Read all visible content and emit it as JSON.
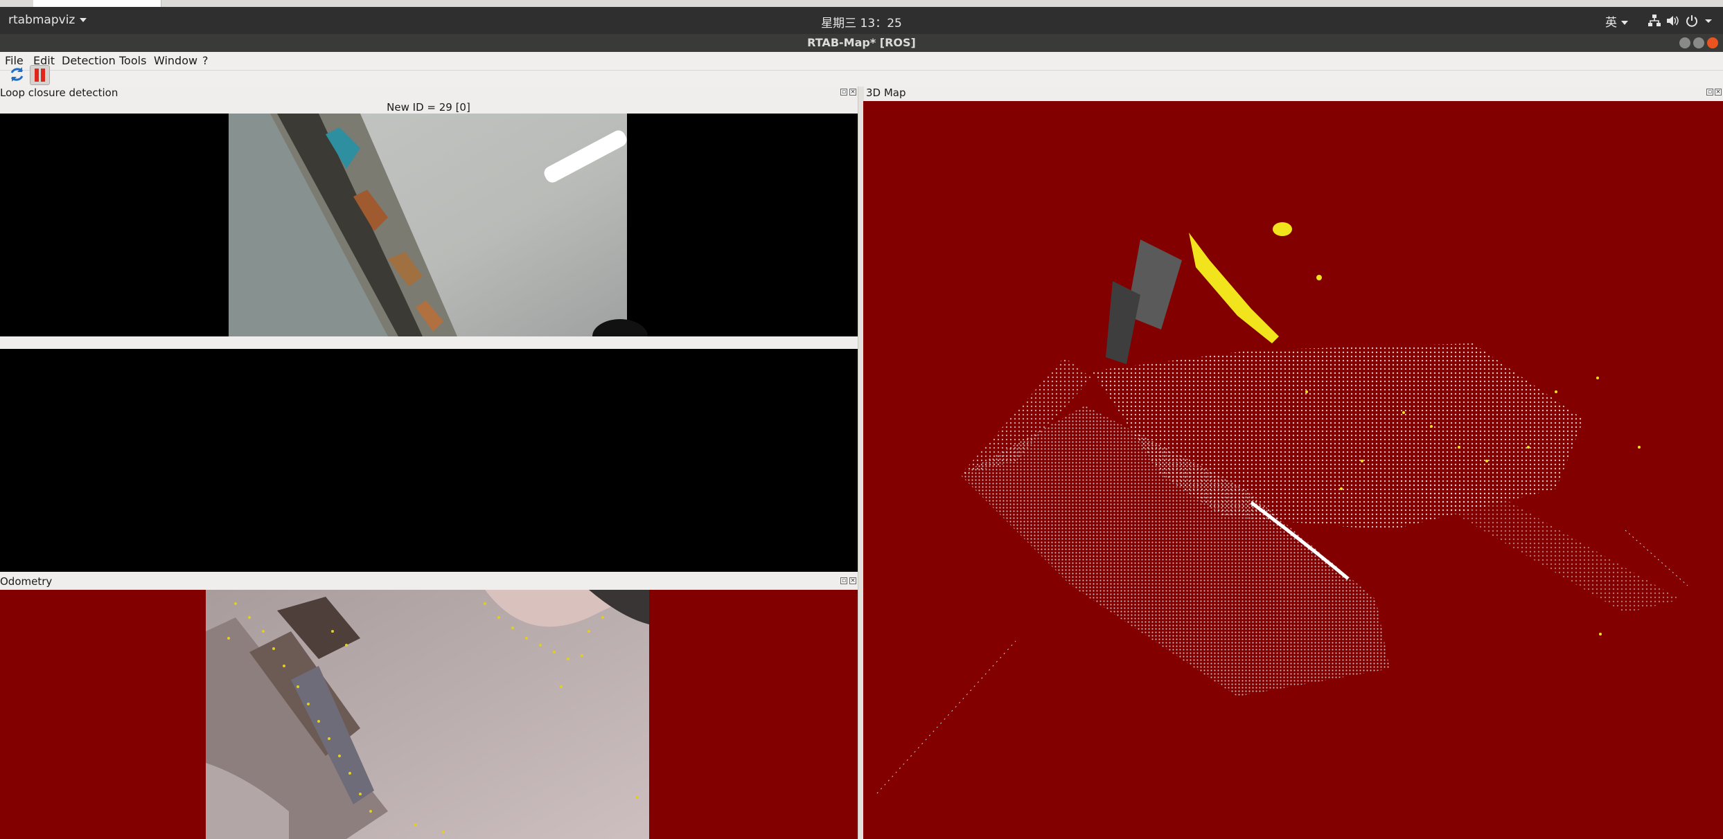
{
  "top_panel": {
    "app_menu": "rtabmapviz",
    "clock": "星期三 13：25",
    "input_method": "英"
  },
  "window": {
    "title": "RTAB-Map* [ROS]"
  },
  "menubar": [
    "File",
    "Edit",
    "Detection",
    "Tools",
    "Window",
    "?"
  ],
  "toolbar": {
    "buttons": [
      "refresh-icon",
      "pause-icon"
    ]
  },
  "loop_closure": {
    "title": "Loop closure detection",
    "new_id_label": "New ID = 29 [0]"
  },
  "odometry": {
    "title": "Odometry"
  },
  "map3d": {
    "title": "3D Map"
  },
  "colors": {
    "panel_bg": "#efeeec",
    "view_bg_red": "#830000",
    "loop_bg": "#000000",
    "top_bar": "#2f2f2f",
    "features_yellow": "#f2e41c"
  }
}
